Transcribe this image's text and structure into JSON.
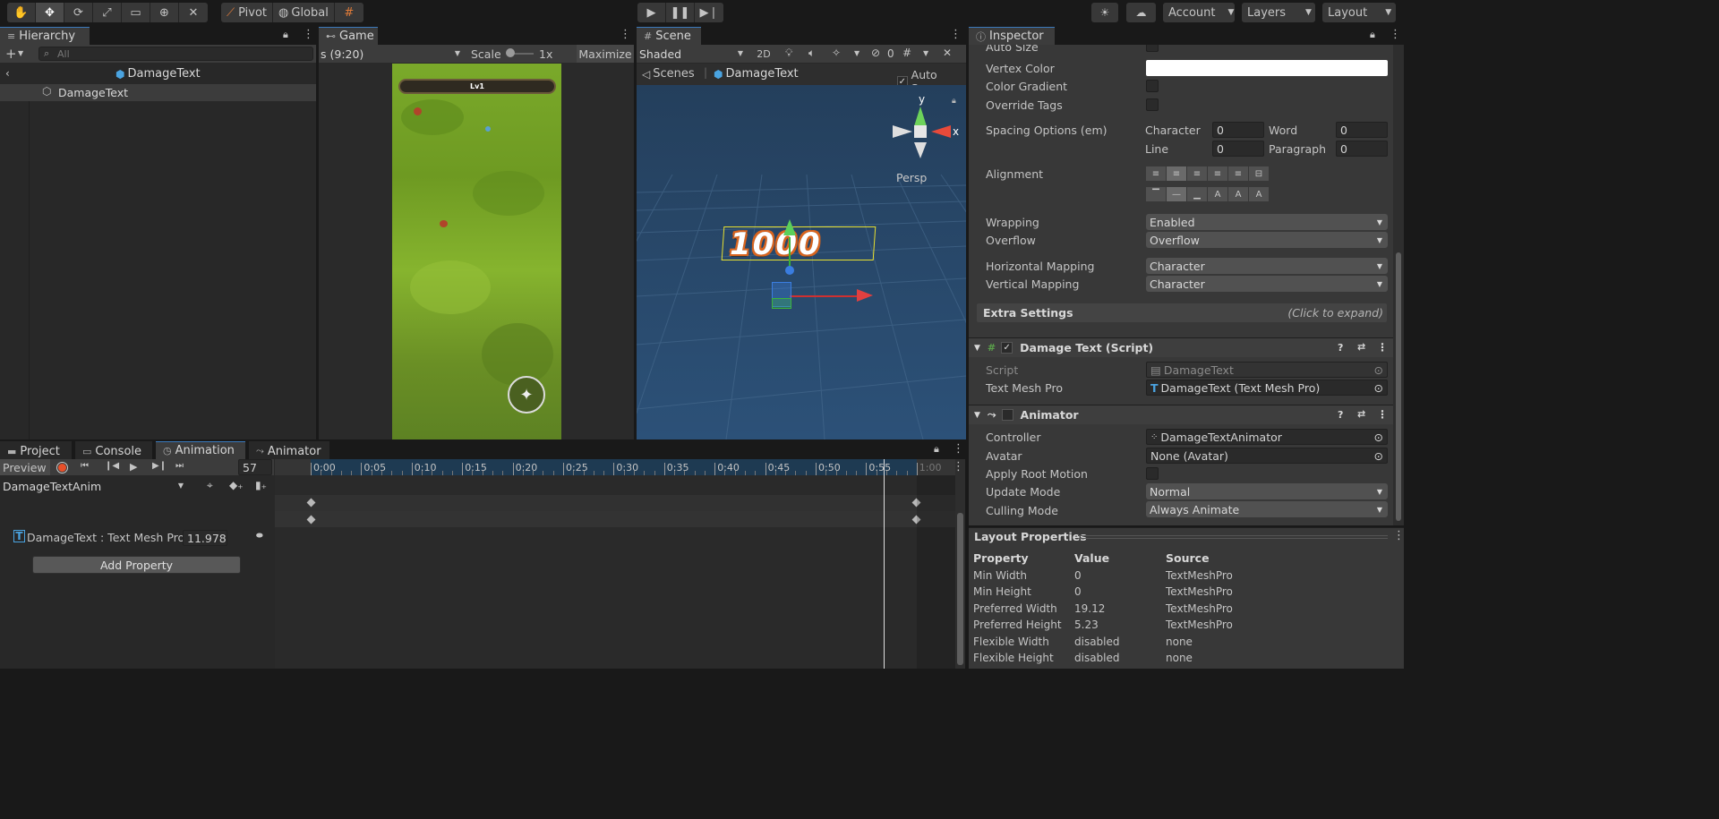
{
  "toolbar": {
    "pivot_label": "Pivot",
    "global_label": "Global",
    "account_label": "Account",
    "layers_label": "Layers",
    "layout_label": "Layout"
  },
  "hierarchy": {
    "tab_label": "Hierarchy",
    "search_placeholder": "All",
    "breadcrumb_title": "DamageText",
    "items": [
      {
        "label": "DamageText"
      }
    ]
  },
  "game": {
    "tab_label": "Game",
    "resolution": "s (9:20)",
    "scale_label": "Scale",
    "scale_value": "1x",
    "maximize_label": "Maximize",
    "hud_level": "Lv1"
  },
  "scene": {
    "tab_label": "Scene",
    "shading_mode": "Shaded",
    "mode_2d": "2D",
    "hidden_count": "0",
    "breadcrumb_scenes": "Scenes",
    "breadcrumb_object": "DamageText",
    "auto_save_label": "Auto Save",
    "gizmo_y": "y",
    "gizmo_x": "x",
    "persp_label": "Persp",
    "damage_value": "1000"
  },
  "inspector": {
    "tab_label": "Inspector",
    "auto_size_label": "Auto Size",
    "vertex_color_label": "Vertex Color",
    "vertex_color_value": "#ffffff",
    "color_gradient_label": "Color Gradient",
    "override_tags_label": "Override Tags",
    "spacing_label": "Spacing Options (em)",
    "character_label": "Character",
    "character_value": "0",
    "word_label": "Word",
    "word_value": "0",
    "line_label": "Line",
    "line_value": "0",
    "paragraph_label": "Paragraph",
    "paragraph_value": "0",
    "alignment_label": "Alignment",
    "wrapping_label": "Wrapping",
    "wrapping_value": "Enabled",
    "overflow_label": "Overflow",
    "overflow_value": "Overflow",
    "hmapping_label": "Horizontal Mapping",
    "hmapping_value": "Character",
    "vmapping_label": "Vertical Mapping",
    "vmapping_value": "Character",
    "extra_settings_label": "Extra Settings",
    "extra_settings_hint": "(Click to expand)",
    "damage_script_header": "Damage Text (Script)",
    "script_label": "Script",
    "script_value": "DamageText",
    "tmp_label": "Text Mesh Pro",
    "tmp_value": "DamageText (Text Mesh Pro)",
    "animator_header": "Animator",
    "controller_label": "Controller",
    "controller_value": "DamageTextAnimator",
    "avatar_label": "Avatar",
    "avatar_value": "None (Avatar)",
    "apply_root_label": "Apply Root Motion",
    "update_mode_label": "Update Mode",
    "update_mode_value": "Normal",
    "culling_mode_label": "Culling Mode",
    "culling_mode_value": "Always Animate"
  },
  "layout_props": {
    "title": "Layout Properties",
    "headers": [
      "Property",
      "Value",
      "Source"
    ],
    "rows": [
      [
        "Min Width",
        "0",
        "TextMeshPro"
      ],
      [
        "Min Height",
        "0",
        "TextMeshPro"
      ],
      [
        "Preferred Width",
        "19.12",
        "TextMeshPro"
      ],
      [
        "Preferred Height",
        "5.23",
        "TextMeshPro"
      ],
      [
        "Flexible Width",
        "disabled",
        "none"
      ],
      [
        "Flexible Height",
        "disabled",
        "none"
      ]
    ]
  },
  "animation": {
    "tabs": [
      "Project",
      "Console",
      "Animation",
      "Animator"
    ],
    "preview_label": "Preview",
    "frame_value": "57",
    "clip_name": "DamageTextAnim",
    "property_label": "DamageText : Text Mesh Pro",
    "property_value": "11.978",
    "add_property_label": "Add Property",
    "timeline_ticks": [
      "0:00",
      "0:05",
      "0:10",
      "0:15",
      "0:20",
      "0:25",
      "0:30",
      "0:35",
      "0:40",
      "0:45",
      "0:50",
      "0:55",
      "1:00"
    ]
  }
}
